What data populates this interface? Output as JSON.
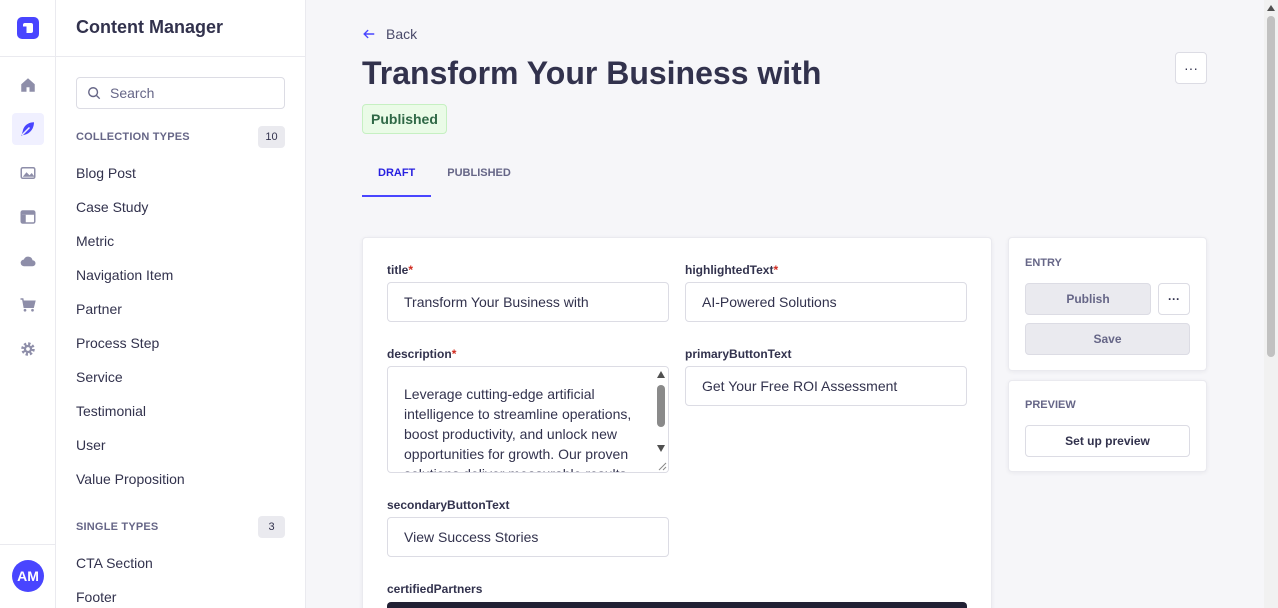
{
  "app": {
    "section_title": "Content Manager",
    "avatar_initials": "AM",
    "accent_color": "#4945ff"
  },
  "rail": {
    "icons": [
      "home-icon",
      "feather-icon",
      "image-icon",
      "layout-icon",
      "cloud-icon",
      "cart-icon",
      "gear-icon"
    ]
  },
  "sidebar": {
    "search_placeholder": "Search",
    "collection": {
      "label": "COLLECTION TYPES",
      "count": "10",
      "items": [
        "Blog Post",
        "Case Study",
        "Metric",
        "Navigation Item",
        "Partner",
        "Process Step",
        "Service",
        "Testimonial",
        "User",
        "Value Proposition"
      ]
    },
    "single": {
      "label": "SINGLE TYPES",
      "count": "3",
      "items": [
        "CTA Section",
        "Footer"
      ]
    }
  },
  "header": {
    "back_label": "Back",
    "title": "Transform Your Business with",
    "more_label": "···",
    "status": "Published",
    "tabs": [
      "DRAFT",
      "PUBLISHED"
    ]
  },
  "form": {
    "title_label": "title",
    "title_value": "Transform Your Business with",
    "highlighted_label": "highlightedText",
    "highlighted_value": "AI-Powered Solutions",
    "description_label": "description",
    "description_value": "Leverage cutting-edge artificial intelligence to streamline operations, boost productivity, and unlock new opportunities for growth. Our proven solutions deliver measurable results",
    "primary_label": "primaryButtonText",
    "primary_value": "Get Your Free ROI Assessment",
    "secondary_label": "secondaryButtonText",
    "secondary_value": "View Success Stories",
    "certified_label": "certifiedPartners",
    "required_mark": "*"
  },
  "entry": {
    "label": "ENTRY",
    "publish": "Publish",
    "more": "···",
    "save": "Save"
  },
  "preview": {
    "label": "PREVIEW",
    "setup": "Set up preview"
  }
}
